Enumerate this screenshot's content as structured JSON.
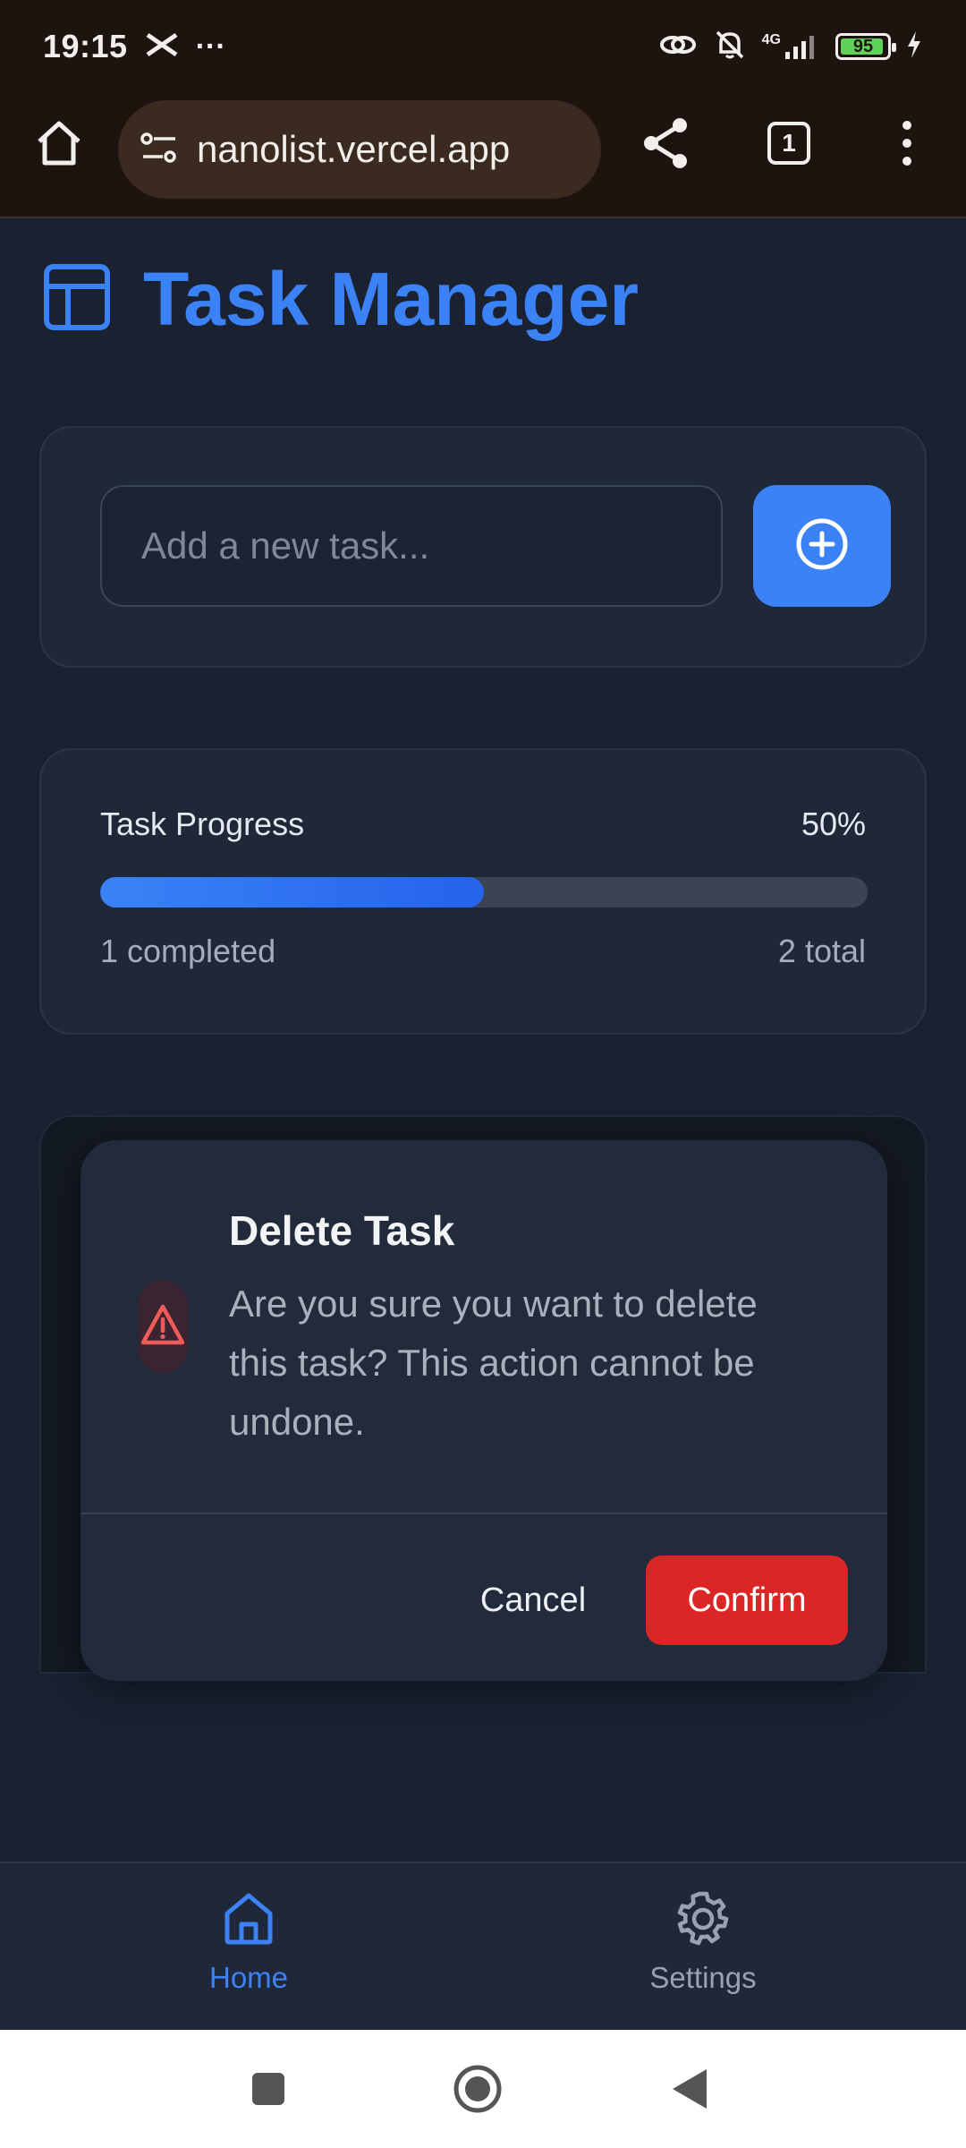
{
  "status_bar": {
    "time": "19:15",
    "network": "4G",
    "battery": "95"
  },
  "browser": {
    "url": "nanolist.vercel.app",
    "tab_count": "1"
  },
  "app": {
    "title": "Task Manager"
  },
  "task_input": {
    "placeholder": "Add a new task..."
  },
  "progress": {
    "label": "Task Progress",
    "percent_text": "50%",
    "fraction": 0.5,
    "completed_text": "1 completed",
    "total_text": "2 total"
  },
  "modal": {
    "title": "Delete Task",
    "message": "Are you sure you want to delete this task? This action cannot be undone.",
    "cancel_label": "Cancel",
    "confirm_label": "Confirm"
  },
  "bottom_nav": {
    "items": [
      {
        "label": "Home",
        "icon": "home-icon",
        "active": true
      },
      {
        "label": "Settings",
        "icon": "gear-icon",
        "active": false
      }
    ]
  },
  "colors": {
    "accent": "#3b82f6",
    "danger": "#dc2626",
    "background": "#1a2232"
  }
}
